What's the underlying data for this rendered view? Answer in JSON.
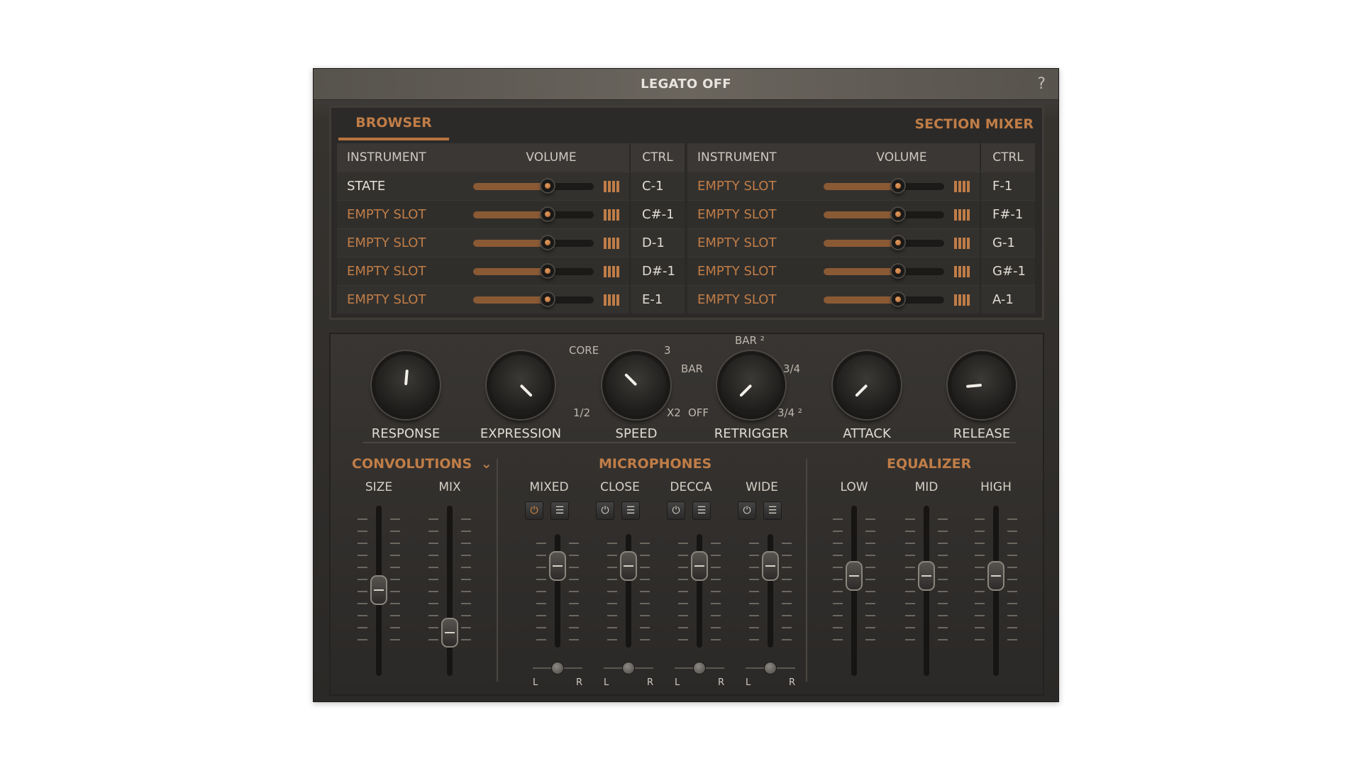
{
  "window": {
    "title": "LEGATO OFF",
    "help": "?"
  },
  "tabs": {
    "browser": "BROWSER",
    "section_mixer": "SECTION MIXER"
  },
  "table_headers": {
    "instrument": "INSTRUMENT",
    "volume": "VOLUME",
    "ctrl": "CTRL"
  },
  "left_rows": [
    {
      "name": "STATE",
      "ctrl": "C-1",
      "volume": 0.62
    },
    {
      "name": "EMPTY SLOT",
      "ctrl": "C#-1",
      "volume": 0.62
    },
    {
      "name": "EMPTY SLOT",
      "ctrl": "D-1",
      "volume": 0.62
    },
    {
      "name": "EMPTY SLOT",
      "ctrl": "D#-1",
      "volume": 0.62
    },
    {
      "name": "EMPTY SLOT",
      "ctrl": "E-1",
      "volume": 0.62
    }
  ],
  "right_rows": [
    {
      "name": "EMPTY SLOT",
      "ctrl": "F-1",
      "volume": 0.62
    },
    {
      "name": "EMPTY SLOT",
      "ctrl": "F#-1",
      "volume": 0.62
    },
    {
      "name": "EMPTY SLOT",
      "ctrl": "G-1",
      "volume": 0.62
    },
    {
      "name": "EMPTY SLOT",
      "ctrl": "G#-1",
      "volume": 0.62
    },
    {
      "name": "EMPTY SLOT",
      "ctrl": "A-1",
      "volume": 0.62
    }
  ],
  "knobs": {
    "response": {
      "label": "RESPONSE"
    },
    "expression": {
      "label": "EXPRESSION"
    },
    "speed": {
      "label": "SPEED",
      "core": "CORE",
      "three": "3",
      "half": "1/2",
      "x2": "X2"
    },
    "retrigger": {
      "label": "RETRIGGER",
      "bar2": "BAR ²",
      "bar": "BAR",
      "three_quarter": "3/4",
      "off": "OFF",
      "three_quarter2": "3/4 ²"
    },
    "attack": {
      "label": "ATTACK"
    },
    "release": {
      "label": "RELEASE"
    }
  },
  "convolutions": {
    "title": "CONVOLUTIONS",
    "size": "SIZE",
    "mix": "MIX"
  },
  "microphones": {
    "title": "MICROPHONES",
    "channels": [
      "MIXED",
      "CLOSE",
      "DECCA",
      "WIDE"
    ],
    "pan_left": "L",
    "pan_right": "R"
  },
  "equalizer": {
    "title": "EQUALIZER",
    "low": "LOW",
    "mid": "MID",
    "high": "HIGH"
  },
  "colors": {
    "accent": "#c07d47",
    "panel": "#2b2927",
    "text": "#e0dbd3"
  }
}
